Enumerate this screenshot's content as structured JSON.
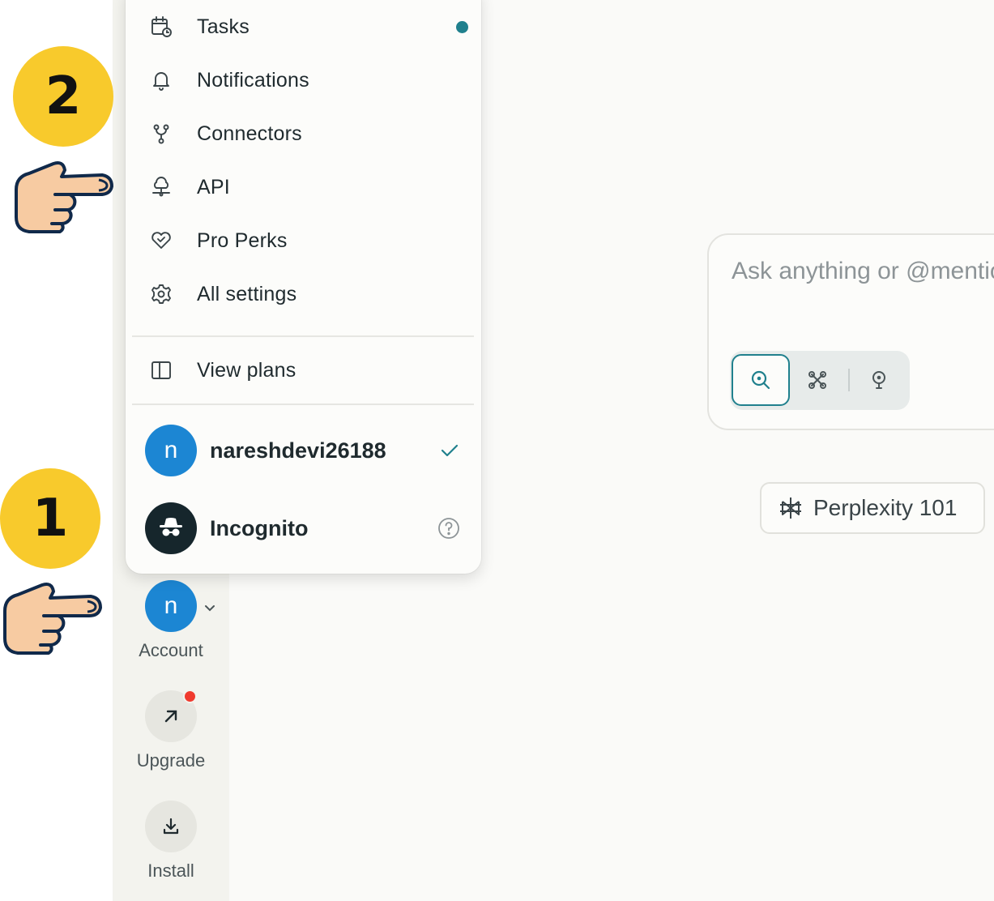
{
  "annotations": {
    "step1": "1",
    "step2": "2"
  },
  "menu": {
    "items": [
      {
        "label": "Tasks",
        "icon": "calendar-clock-icon",
        "has_dot": true
      },
      {
        "label": "Notifications",
        "icon": "bell-icon"
      },
      {
        "label": "Connectors",
        "icon": "connector-icon"
      },
      {
        "label": "API",
        "icon": "api-cloud-icon"
      },
      {
        "label": "Pro Perks",
        "icon": "heart-handshake-icon"
      },
      {
        "label": "All settings",
        "icon": "gear-icon"
      }
    ],
    "view_plans": {
      "label": "View plans",
      "icon": "columns-icon"
    },
    "accounts": [
      {
        "initial": "n",
        "name": "nareshdevi26188",
        "selected": true
      },
      {
        "name": "Incognito",
        "icon": "incognito-icon"
      }
    ]
  },
  "sidebar": {
    "account": {
      "initial": "n",
      "label": "Account"
    },
    "upgrade": {
      "label": "Upgrade"
    },
    "install": {
      "label": "Install"
    }
  },
  "search": {
    "placeholder": "Ask anything or @mention a Space",
    "modes": [
      "search-mode",
      "research-mode",
      "labs-mode"
    ]
  },
  "chip": {
    "label": "Perplexity 101"
  },
  "colors": {
    "accent": "#20808d",
    "avatar": "#1c86d3",
    "badge": "#f8ca2c",
    "notification": "#f03a2e"
  }
}
